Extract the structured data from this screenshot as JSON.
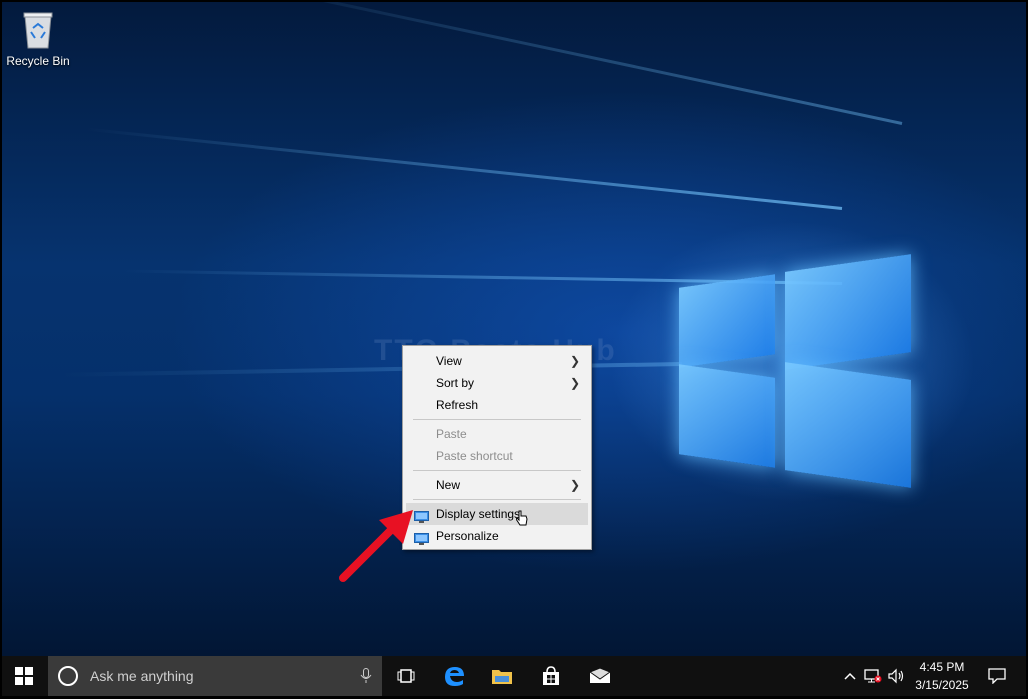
{
  "desktop": {
    "icons": [
      {
        "label": "Recycle Bin",
        "icon": "recycle-bin-icon"
      }
    ],
    "watermark": "TTG Posts Hub"
  },
  "context_menu": {
    "items": [
      {
        "label": "View",
        "submenu": true,
        "enabled": true
      },
      {
        "label": "Sort by",
        "submenu": true,
        "enabled": true
      },
      {
        "label": "Refresh",
        "submenu": false,
        "enabled": true
      },
      {
        "label": "Paste",
        "submenu": false,
        "enabled": false
      },
      {
        "label": "Paste shortcut",
        "submenu": false,
        "enabled": false
      },
      {
        "label": "New",
        "submenu": true,
        "enabled": true
      },
      {
        "label": "Display settings",
        "submenu": false,
        "enabled": true,
        "highlighted": true,
        "icon": "display-icon"
      },
      {
        "label": "Personalize",
        "submenu": false,
        "enabled": true,
        "icon": "display-icon"
      }
    ],
    "submenu_arrow": "❯"
  },
  "taskbar": {
    "search_placeholder": "Ask me anything",
    "pinned": [
      "task-view-icon",
      "edge-icon",
      "file-explorer-icon",
      "store-icon",
      "mail-icon"
    ],
    "clock": {
      "time": "4:45 PM",
      "date": "3/15/2025"
    },
    "colors": {
      "background": "#101010",
      "search_bg": "#3a3a3a"
    }
  }
}
